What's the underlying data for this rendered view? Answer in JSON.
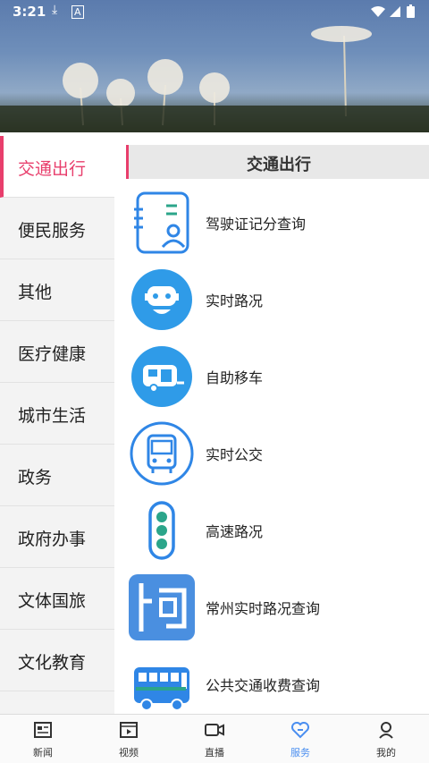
{
  "status_bar": {
    "time": "3:21"
  },
  "sidebar": {
    "items": [
      {
        "label": "交通出行",
        "active": true
      },
      {
        "label": "便民服务"
      },
      {
        "label": "其他"
      },
      {
        "label": "医疗健康"
      },
      {
        "label": "城市生活"
      },
      {
        "label": "政务"
      },
      {
        "label": "政府办事"
      },
      {
        "label": "文体国旅"
      },
      {
        "label": "文化教育"
      }
    ]
  },
  "section": {
    "title": "交通出行"
  },
  "services": [
    {
      "label": "驾驶证记分查询",
      "icon": "license-icon"
    },
    {
      "label": "实时路况",
      "icon": "road-robot-icon"
    },
    {
      "label": "自助移车",
      "icon": "caravan-icon"
    },
    {
      "label": "实时公交",
      "icon": "bus-icon"
    },
    {
      "label": "高速路况",
      "icon": "traffic-light-icon"
    },
    {
      "label": "常州实时路况查询",
      "icon": "road-map-icon"
    },
    {
      "label": "公共交通收费查询",
      "icon": "public-bus-icon"
    }
  ],
  "bottom_nav": [
    {
      "label": "新闻",
      "icon": "news-icon"
    },
    {
      "label": "视频",
      "icon": "video-icon"
    },
    {
      "label": "直播",
      "icon": "camera-icon"
    },
    {
      "label": "服务",
      "icon": "heart-service-icon",
      "active": true
    },
    {
      "label": "我的",
      "icon": "profile-icon"
    }
  ],
  "colors": {
    "accent": "#e83e6c",
    "icon_blue": "#2f86e6",
    "nav_active": "#4a8ef0"
  }
}
